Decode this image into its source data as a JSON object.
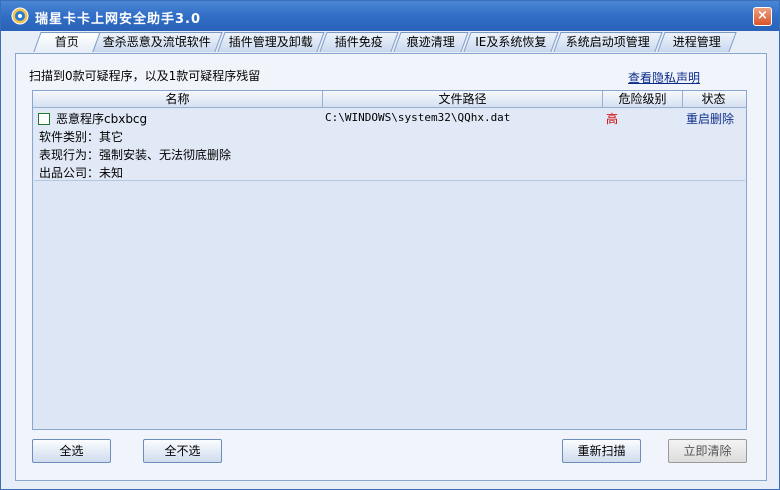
{
  "window": {
    "title": "瑞星卡卡上网安全助手3.0",
    "close_label": "×"
  },
  "tabs": [
    {
      "label": "首页"
    },
    {
      "label": "查杀恶意及流氓软件"
    },
    {
      "label": "插件管理及卸载"
    },
    {
      "label": "插件免疫"
    },
    {
      "label": "痕迹清理"
    },
    {
      "label": "IE及系统恢复"
    },
    {
      "label": "系统启动项管理"
    },
    {
      "label": "进程管理"
    }
  ],
  "summary": "扫描到0款可疑程序，以及1款可疑程序残留",
  "privacy_link": "查看隐私声明",
  "table": {
    "columns": [
      "名称",
      "文件路径",
      "危险级别",
      "状态"
    ],
    "rows": [
      {
        "name": "恶意程序cbxbcg",
        "path": "C:\\WINDOWS\\system32\\QQhx.dat",
        "risk": "高",
        "status": "重启删除",
        "details": [
          "软件类别：其它",
          "表现行为：强制安装、无法彻底删除",
          "出品公司：未知"
        ],
        "checked": false
      }
    ]
  },
  "buttons": {
    "select_all": "全选",
    "select_none": "全不选",
    "rescan": "重新扫描",
    "clean_now": "立即清除"
  },
  "colors": {
    "title_bar": "#2f6cc4",
    "risk_high": "#d40000",
    "link": "#0b2a8a"
  }
}
